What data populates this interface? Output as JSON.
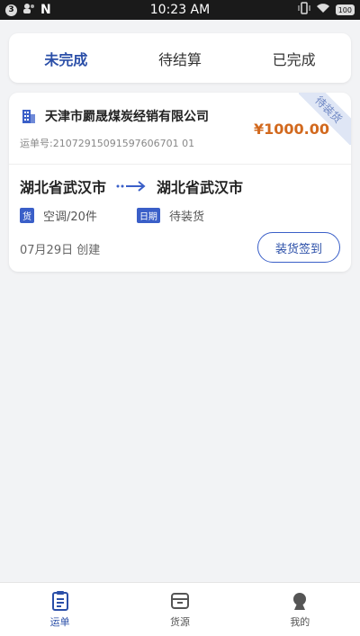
{
  "status_bar": {
    "notif_badge": "3",
    "time": "10:23 AM",
    "battery": "100"
  },
  "tabs": [
    {
      "label": "未完成",
      "active": true
    },
    {
      "label": "待结算",
      "active": false
    },
    {
      "label": "已完成",
      "active": false
    }
  ],
  "order": {
    "company": "天津市罽晟煤炭经销有限公司",
    "waybill": "运单号:21072915091597606701 01",
    "price": "¥1000.00",
    "status_ribbon": "待装货",
    "origin": "湖北省武汉市",
    "destination": "湖北省武汉市",
    "goods_tag": "货",
    "goods": "空调/20件",
    "date_tag": "日期",
    "date_status": "待装货",
    "created": "07月29日 创建",
    "action_button": "装货签到"
  },
  "bottom_nav": [
    {
      "label": "运单",
      "icon": "waybill-icon",
      "active": true
    },
    {
      "label": "货源",
      "icon": "goods-source-icon",
      "active": false
    },
    {
      "label": "我的",
      "icon": "profile-icon",
      "active": false
    }
  ],
  "colors": {
    "accent": "#2b4fa8",
    "price": "#d2691e",
    "background": "#f2f3f5"
  }
}
